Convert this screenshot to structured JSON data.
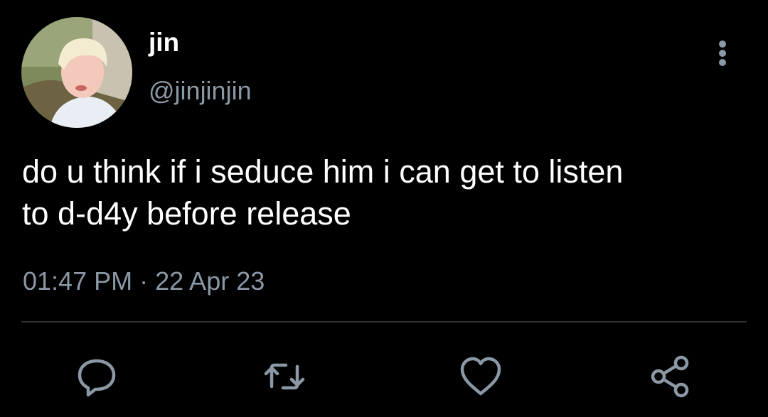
{
  "author": {
    "display_name": "jin",
    "handle": "@jinjinjin"
  },
  "tweet": {
    "text": "do u think if i seduce him i can get to listen\nto d-d4y before release",
    "time": "01:47 PM",
    "separator": "·",
    "date": "22 Apr 23"
  },
  "actions": [
    {
      "icon": "reply-icon"
    },
    {
      "icon": "retweet-icon"
    },
    {
      "icon": "like-icon"
    },
    {
      "icon": "share-icon"
    }
  ],
  "colors": {
    "background": "#000000",
    "primary_text": "#ffffff",
    "secondary_text": "#8b98a5",
    "divider": "#2f3336"
  }
}
